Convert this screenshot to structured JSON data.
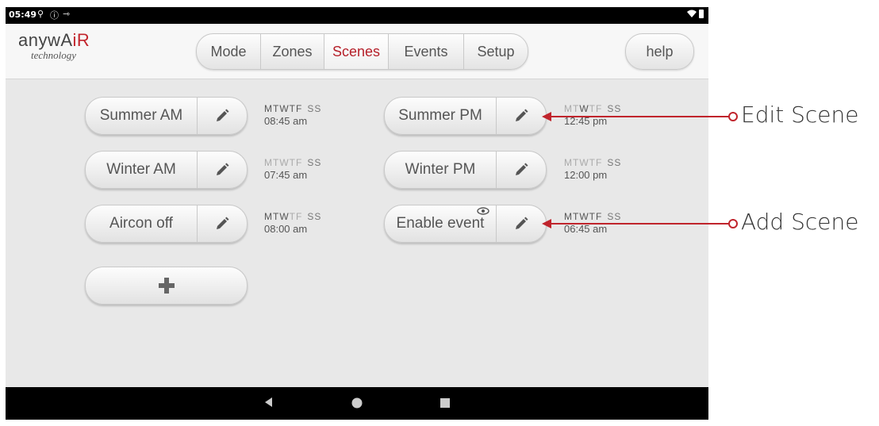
{
  "status_bar": {
    "time": "05:49"
  },
  "logo": {
    "brand_main": "anywA",
    "brand_accent": "iR",
    "sub": "technology"
  },
  "tabs": [
    {
      "label": "Mode",
      "active": false
    },
    {
      "label": "Zones",
      "active": false
    },
    {
      "label": "Scenes",
      "active": true
    },
    {
      "label": "Events",
      "active": false
    },
    {
      "label": "Setup",
      "active": false
    }
  ],
  "help_label": "help",
  "scenes": [
    {
      "name": "Summer AM",
      "days_active": [
        true,
        true,
        true,
        true,
        true,
        false,
        false
      ],
      "time": "08:45 am"
    },
    {
      "name": "Summer PM",
      "days_active": [
        false,
        false,
        true,
        false,
        false,
        false,
        false
      ],
      "time": "12:45 pm"
    },
    {
      "name": "Winter AM",
      "days_active": [
        false,
        false,
        false,
        false,
        false,
        false,
        false
      ],
      "time": "07:45 am"
    },
    {
      "name": "Winter PM",
      "days_active": [
        false,
        false,
        false,
        false,
        false,
        false,
        false
      ],
      "time": "12:00 pm"
    },
    {
      "name": "Aircon off",
      "days_active": [
        true,
        true,
        true,
        false,
        false,
        false,
        false
      ],
      "time": "08:00 am"
    },
    {
      "name": "Enable event",
      "days_active": [
        true,
        true,
        true,
        true,
        true,
        false,
        false
      ],
      "time": "06:45 am"
    }
  ],
  "day_letters": [
    "M",
    "T",
    "W",
    "T",
    "F",
    "S",
    "S"
  ],
  "annotations": {
    "edit_scene": "Edit Scene",
    "add_scene": "Add Scene"
  },
  "colors": {
    "accent": "#c2252d",
    "annotation": "#c0242c"
  }
}
